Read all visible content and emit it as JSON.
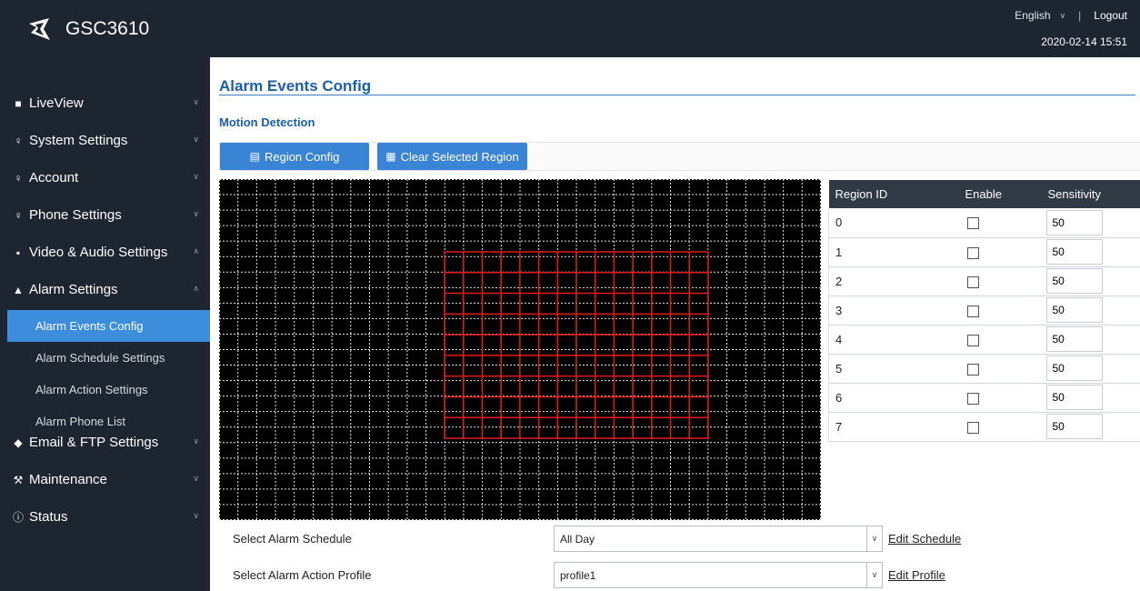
{
  "app": {
    "brand": "GSC3610",
    "language": "English",
    "logout": "Logout",
    "datetime": "2020-02-14 15:51"
  },
  "sidebar": {
    "items": [
      {
        "label": "LiveView",
        "icon": "video-icon",
        "chevron": "down"
      },
      {
        "label": "System Settings",
        "icon": "key-icon",
        "chevron": "down"
      },
      {
        "label": "Account",
        "icon": "key-icon",
        "chevron": "down"
      },
      {
        "label": "Phone Settings",
        "icon": "key-icon",
        "chevron": "down"
      },
      {
        "label": "Video & Audio Settings",
        "icon": "camera-icon",
        "chevron": "up"
      },
      {
        "label": "Alarm Settings",
        "icon": "bell-icon",
        "chevron": "up"
      },
      {
        "label": "Email & FTP Settings",
        "icon": "mail-icon",
        "chevron": "down"
      },
      {
        "label": "Maintenance",
        "icon": "wrench-icon",
        "chevron": "down"
      },
      {
        "label": "Status",
        "icon": "info-icon",
        "chevron": "down"
      }
    ],
    "alarm_sub_items": [
      {
        "label": "Alarm Events Config",
        "active": true
      },
      {
        "label": "Alarm Schedule Settings",
        "active": false
      },
      {
        "label": "Alarm Action Settings",
        "active": false
      },
      {
        "label": "Alarm Phone List",
        "active": false
      }
    ]
  },
  "main": {
    "page_title": "Alarm Events Config",
    "section_title": "Motion Detection",
    "buttons": {
      "region_config": "Region Config",
      "clear_region": "Clear Selected Region"
    },
    "region_table": {
      "headers": [
        "Region ID",
        "Enable",
        "Sensitivity"
      ],
      "rows": [
        {
          "id": "0",
          "enabled": false,
          "sensitivity": "50"
        },
        {
          "id": "1",
          "enabled": false,
          "sensitivity": "50"
        },
        {
          "id": "2",
          "enabled": false,
          "sensitivity": "50"
        },
        {
          "id": "3",
          "enabled": false,
          "sensitivity": "50"
        },
        {
          "id": "4",
          "enabled": false,
          "sensitivity": "50"
        },
        {
          "id": "5",
          "enabled": false,
          "sensitivity": "50"
        },
        {
          "id": "6",
          "enabled": false,
          "sensitivity": "50"
        },
        {
          "id": "7",
          "enabled": false,
          "sensitivity": "50"
        }
      ]
    },
    "form": {
      "schedule_label": "Select Alarm Schedule",
      "schedule_value": "All Day",
      "schedule_link": "Edit Schedule",
      "profile_label": "Select Alarm Action Profile",
      "profile_value": "profile1",
      "profile_link": "Edit Profile"
    }
  },
  "colors": {
    "sidebar_bg": "#1c2530",
    "accent": "#3a84d6",
    "title": "#1a5fa8",
    "region_outline": "#e21b1b"
  }
}
